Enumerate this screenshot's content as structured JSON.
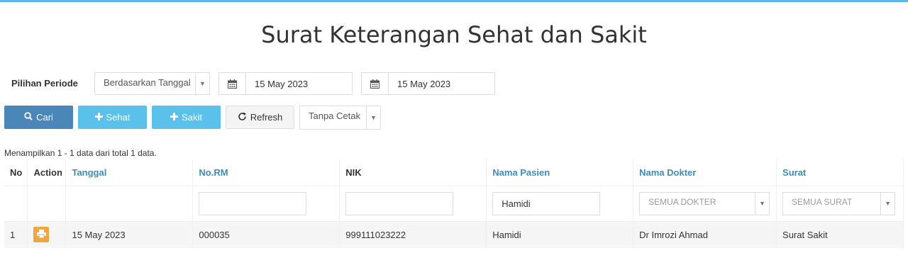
{
  "page": {
    "title": "Surat Keterangan Sehat dan Sakit"
  },
  "periode": {
    "label": "Pilihan Periode",
    "mode_value": "Berdasarkan Tanggal",
    "date_from": "15 May 2023",
    "date_to": "15 May 2023"
  },
  "toolbar": {
    "cari_label": "Cari",
    "sehat_label": "Sehat",
    "sakit_label": "Sakit",
    "refresh_label": "Refresh",
    "cetak_value": "Tanpa Cetak"
  },
  "summary": "Menampilkan 1 - 1 data dari total 1 data.",
  "table": {
    "headers": {
      "no": "No",
      "action": "Action",
      "tanggal": "Tanggal",
      "norm": "No.RM",
      "nik": "NIK",
      "nama_pasien": "Nama Pasien",
      "nama_dokter": "Nama Dokter",
      "surat": "Surat"
    },
    "filters": {
      "norm": "",
      "nik": "",
      "nama_pasien": "Hamidi",
      "dokter_placeholder": "SEMUA DOKTER",
      "surat_placeholder": "SEMUA SURAT"
    },
    "rows": [
      {
        "no": "1",
        "tanggal": "15 May 2023",
        "norm": "000035",
        "nik": "999111023222",
        "nama_pasien": "Hamidi",
        "nama_dokter": "Dr Imrozi Ahmad",
        "surat": "Surat Sakit"
      }
    ]
  },
  "colors": {
    "accent": "#5bb8e8",
    "primary": "#4a86b8",
    "info": "#5bc0ea",
    "link": "#3c8dbc",
    "print": "#f0a640"
  },
  "icons": [
    "search-icon",
    "plus-icon",
    "refresh-icon",
    "calendar-icon",
    "print-icon",
    "caret-down-icon"
  ]
}
